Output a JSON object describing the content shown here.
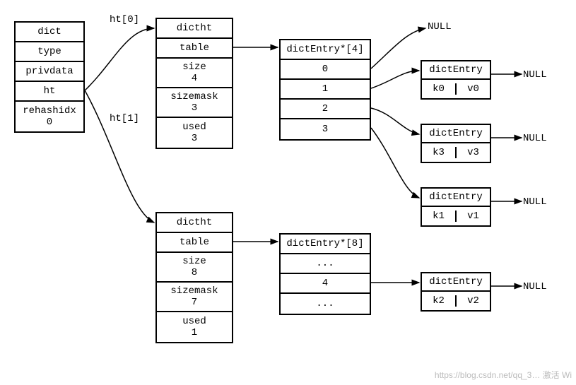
{
  "dict": {
    "title": "dict",
    "rows": [
      "type",
      "privdata",
      "ht"
    ],
    "rehash_label": "rehashidx",
    "rehash_value": "0"
  },
  "ht_labels": {
    "ht0": "ht[0]",
    "ht1": "ht[1]"
  },
  "dictht0": {
    "title": "dictht",
    "table_label": "table",
    "size_label": "size",
    "size_value": "4",
    "sizemask_label": "sizemask",
    "sizemask_value": "3",
    "used_label": "used",
    "used_value": "3"
  },
  "dictht1": {
    "title": "dictht",
    "table_label": "table",
    "size_label": "size",
    "size_value": "8",
    "sizemask_label": "sizemask",
    "sizemask_value": "7",
    "used_label": "used",
    "used_value": "1"
  },
  "tableA": {
    "header": "dictEntry*[4]",
    "slots": [
      "0",
      "1",
      "2",
      "3"
    ]
  },
  "tableB": {
    "header": "dictEntry*[8]",
    "slots": [
      "...",
      "4",
      "..."
    ]
  },
  "entries": {
    "e0": {
      "title": "dictEntry",
      "k": "k0",
      "v": "v0"
    },
    "e1": {
      "title": "dictEntry",
      "k": "k3",
      "v": "v3"
    },
    "e2": {
      "title": "dictEntry",
      "k": "k1",
      "v": "v1"
    },
    "e3": {
      "title": "dictEntry",
      "k": "k2",
      "v": "v2"
    }
  },
  "null_labels": {
    "top": "NULL",
    "n0": "NULL",
    "n1": "NULL",
    "n2": "NULL",
    "n3": "NULL"
  },
  "watermark": "https://blog.csdn.net/qq_3… 激活 Wi"
}
